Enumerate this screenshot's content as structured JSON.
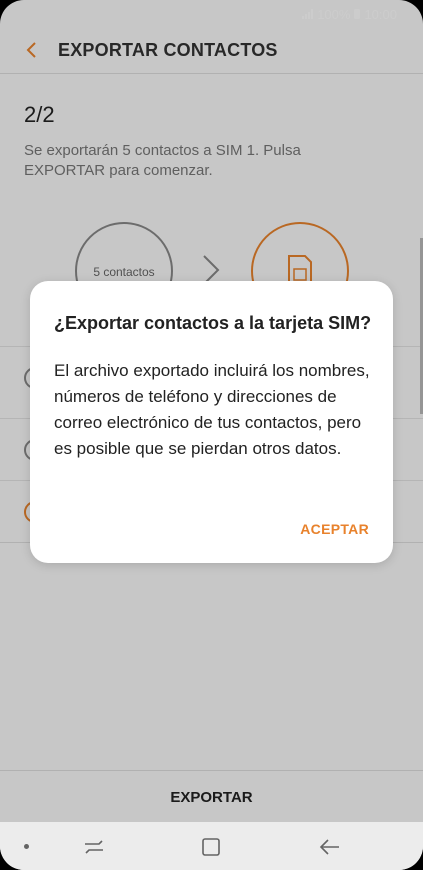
{
  "status": {
    "battery_pct": "100%",
    "time": "10:00"
  },
  "appbar": {
    "title": "EXPORTAR CONTACTOS"
  },
  "page": {
    "step": "2/2",
    "description": "Se exportarán 5 contactos a SIM 1. Pulsa EXPORTAR para comenzar.",
    "source_label": "5 contactos"
  },
  "bottom": {
    "export_label": "EXPORTAR"
  },
  "dialog": {
    "title": "¿Exportar contactos a la tarjeta SIM?",
    "body": "El archivo exportado incluirá los nombres, números de teléfono y direcciones de correo electrónico de tus contactos, pero es posible que se pierdan otros datos.",
    "accept_label": "ACEPTAR"
  },
  "colors": {
    "accent": "#e8822c"
  }
}
